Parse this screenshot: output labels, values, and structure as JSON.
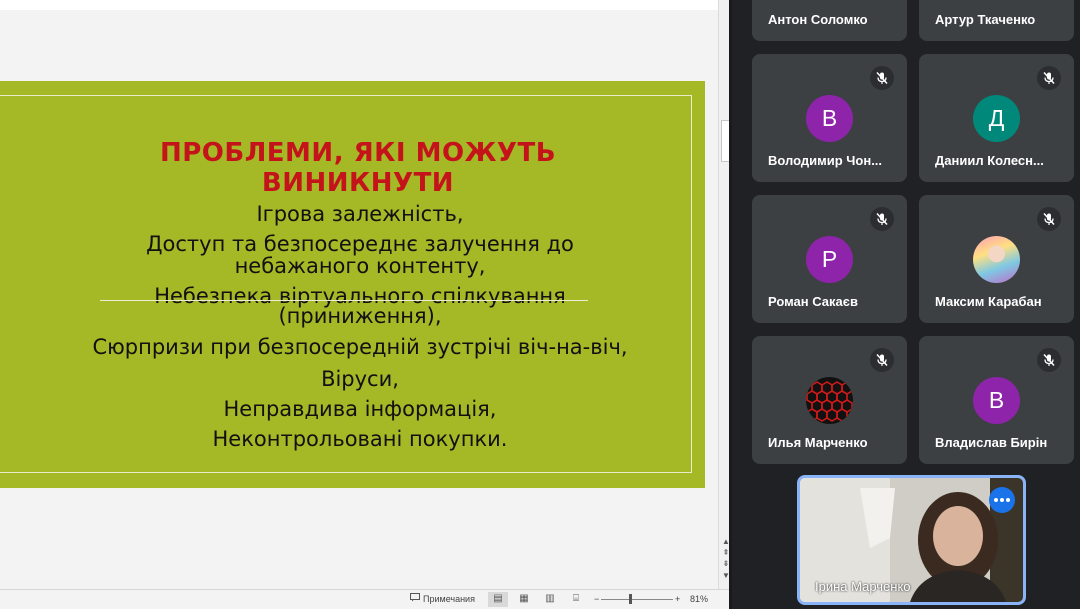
{
  "slide": {
    "title": "ПРОБЛЕМИ, ЯКІ МОЖУТЬ ВИНИКНУТИ",
    "lines": [
      "Ігрова залежність,",
      "Доступ та безпосереднє залучення до",
      "небажаного контенту,",
      "Небезпека віртуального спілкування",
      "(приниження),",
      "Сюрпризи при безпосередній зустрічі віч-на-віч,",
      "Віруси,",
      "Неправдива інформація,",
      "Неконтрольовані покупки."
    ],
    "background_color": "#a5b826",
    "title_color": "#c4131a"
  },
  "status_bar": {
    "notes_label": "Примечания",
    "zoom_level": "81%"
  },
  "participants": [
    {
      "name": "Антон Соломко"
    },
    {
      "name": "Артур Ткаченко"
    },
    {
      "name": "Володимир Чон...",
      "initial": "В",
      "color": "#8e24aa"
    },
    {
      "name": "Даниил Колесн...",
      "initial": "Д",
      "color": "#00897b"
    },
    {
      "name": "Роман Сакаєв",
      "initial": "Р",
      "color": "#8e24aa"
    },
    {
      "name": "Максим Карабан",
      "avatar": "photo-avatar"
    },
    {
      "name": "Илья Марченко",
      "avatar": "hex-pattern-avatar"
    },
    {
      "name": "Владислав Бирін",
      "initial": "В",
      "color": "#8e24aa"
    }
  ],
  "self": {
    "name": "Ірина Марченко"
  },
  "icons": {
    "mic": "mic-off-icon",
    "more": "more-options-icon"
  }
}
